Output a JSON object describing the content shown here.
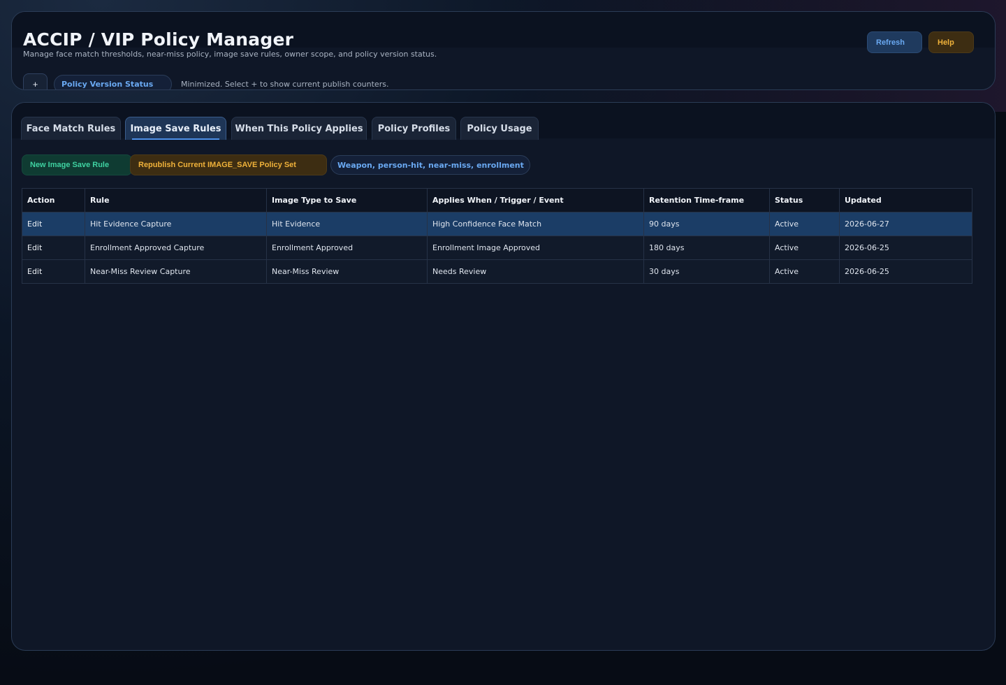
{
  "header": {
    "title": "ACCIP / VIP Policy Manager",
    "subtitle": "Manage face match thresholds, near-miss policy, image save rules, owner scope, and policy version status.",
    "refresh_label": "Refresh",
    "help_label": "Help",
    "expand_label": "+",
    "policy_version_label": "Policy Version Status",
    "policy_version_note": "Minimized. Select + to show current publish counters."
  },
  "tabs": [
    {
      "label": "Face Match Rules",
      "active": false
    },
    {
      "label": "Image Save Rules",
      "active": true
    },
    {
      "label": "When This Policy Applies",
      "active": false
    },
    {
      "label": "Policy Profiles",
      "active": false
    },
    {
      "label": "Policy Usage",
      "active": false
    }
  ],
  "actions": {
    "new_rule_label": "New Image Save Rule",
    "republish_label": "Republish Current IMAGE_SAVE Policy Set",
    "scope_label": "Weapon, person-hit, near-miss, enrollment"
  },
  "table": {
    "columns": [
      "Action",
      "Rule",
      "Image Type to Save",
      "Applies When / Trigger / Event",
      "Retention Time-frame",
      "Status",
      "Updated"
    ],
    "rows": [
      {
        "action": "Edit",
        "rule": "Hit Evidence Capture",
        "image_type": "Hit Evidence",
        "trigger": "High Confidence Face Match",
        "retention": "90 days",
        "status": "Active",
        "updated": "2026-06-27",
        "selected": true
      },
      {
        "action": "Edit",
        "rule": "Enrollment Approved Capture",
        "image_type": "Enrollment Approved",
        "trigger": "Enrollment Image Approved",
        "retention": "180 days",
        "status": "Active",
        "updated": "2026-06-25",
        "selected": false
      },
      {
        "action": "Edit",
        "rule": "Near-Miss Review Capture",
        "image_type": "Near-Miss Review",
        "trigger": "Needs Review",
        "retention": "30 days",
        "status": "Active",
        "updated": "2026-06-25",
        "selected": false
      }
    ]
  },
  "colors": {
    "accent_blue": "#6aa9f2",
    "accent_green": "#3fd2a1",
    "accent_amber": "#f0b23a",
    "selected_row": "#1b3d66"
  }
}
